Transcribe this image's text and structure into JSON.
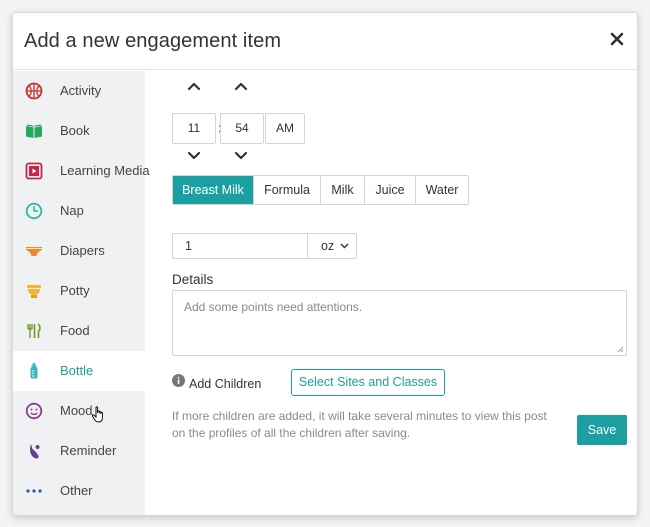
{
  "modal": {
    "title": "Add a new engagement item"
  },
  "sidebar": {
    "items": [
      {
        "label": "Activity",
        "icon": "basketball-icon"
      },
      {
        "label": "Book",
        "icon": "book-icon"
      },
      {
        "label": "Learning Media",
        "icon": "media-icon"
      },
      {
        "label": "Nap",
        "icon": "clock-icon"
      },
      {
        "label": "Diapers",
        "icon": "diaper-icon"
      },
      {
        "label": "Potty",
        "icon": "potty-icon"
      },
      {
        "label": "Food",
        "icon": "utensils-icon"
      },
      {
        "label": "Bottle",
        "icon": "bottle-icon"
      },
      {
        "label": "Mood",
        "icon": "smiley-icon"
      },
      {
        "label": "Reminder",
        "icon": "reminder-icon"
      },
      {
        "label": "Other",
        "icon": "more-icon"
      }
    ],
    "active": "Bottle"
  },
  "time": {
    "hour": "11",
    "separator": ":",
    "minute": "54",
    "meridiem": "AM"
  },
  "types": {
    "options": [
      "Breast Milk",
      "Formula",
      "Milk",
      "Juice",
      "Water"
    ],
    "selected": "Breast Milk"
  },
  "amount": {
    "value": "1",
    "unit": "oz"
  },
  "details": {
    "label": "Details",
    "placeholder": "Add some points need attentions."
  },
  "children": {
    "label": "Add Children",
    "select_button": "Select Sites and Classes",
    "note": "If more children are added, it will take several minutes to view this post on the profiles of all the children after saving."
  },
  "actions": {
    "save": "Save"
  },
  "colors": {
    "accent": "#1b9fa0",
    "sidebar_bg": "#f0f1f2"
  }
}
